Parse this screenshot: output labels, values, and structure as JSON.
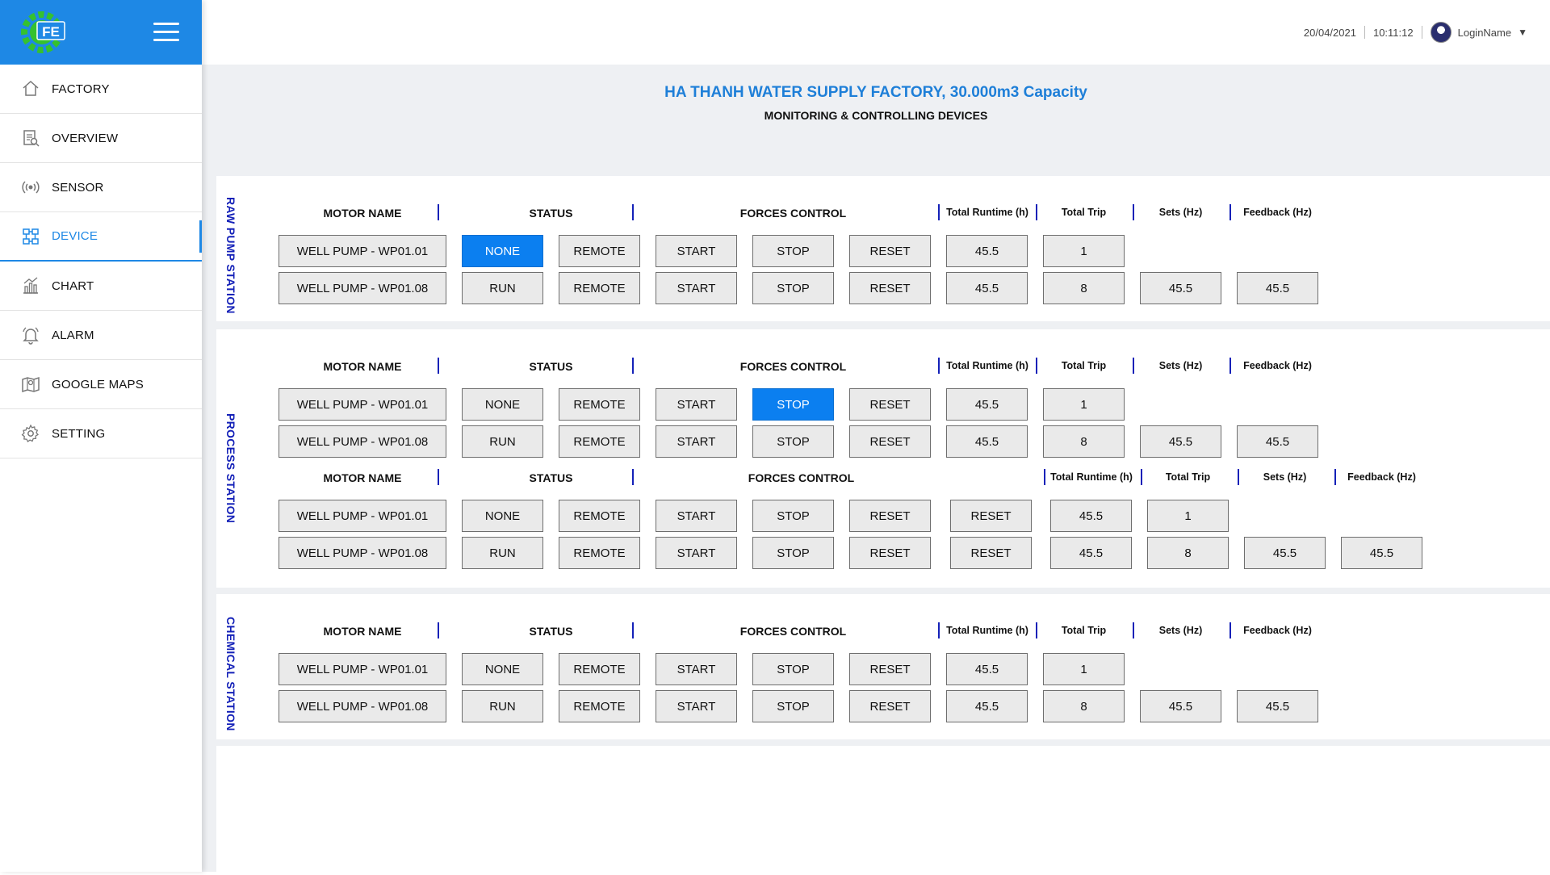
{
  "brand": {
    "logo_text": "FE"
  },
  "nav": [
    {
      "label": "FACTORY",
      "icon": "home-icon"
    },
    {
      "label": "OVERVIEW",
      "icon": "overview-icon"
    },
    {
      "label": "SENSOR",
      "icon": "sensor-icon"
    },
    {
      "label": "DEVICE",
      "icon": "device-icon",
      "active": true
    },
    {
      "label": "CHART",
      "icon": "chart-icon"
    },
    {
      "label": "ALARM",
      "icon": "bell-icon"
    },
    {
      "label": "GOOGLE MAPS",
      "icon": "map-icon"
    },
    {
      "label": "SETTING",
      "icon": "gear-icon"
    }
  ],
  "topbar": {
    "date": "20/04/2021",
    "time": "10:11:12",
    "user": "LoginName",
    "caret": "▼"
  },
  "page": {
    "title": "HA THANH WATER SUPPLY FACTORY, 30.000m3 Capacity",
    "subtitle": "MONITORING & CONTROLLING DEVICES"
  },
  "headers": {
    "motor_name": "MOTOR NAME",
    "status": "STATUS",
    "forces_control": "FORCES CONTROL",
    "total_runtime": "Total Runtime (h)",
    "total_trip": "Total Trip",
    "sets": "Sets (Hz)",
    "feedback": "Feedback (Hz)"
  },
  "stations": [
    {
      "name": "RAW PUMP STATION",
      "rows": [
        {
          "motor": "WELL PUMP - WP01.01",
          "status": "NONE",
          "mode": "REMOTE",
          "start": "START",
          "stop": "STOP",
          "reset": "RESET",
          "runtime": "45.5",
          "trip": "1",
          "sets": "",
          "feedback": "",
          "highlight": "status"
        },
        {
          "motor": "WELL PUMP - WP01.08",
          "status": "RUN",
          "mode": "REMOTE",
          "start": "START",
          "stop": "STOP",
          "reset": "RESET",
          "runtime": "45.5",
          "trip": "8",
          "sets": "45.5",
          "feedback": "45.5"
        }
      ]
    },
    {
      "name": "PROCESS STATION",
      "rows": [
        {
          "motor": "WELL PUMP - WP01.01",
          "status": "NONE",
          "mode": "REMOTE",
          "start": "START",
          "stop": "STOP",
          "reset": "RESET",
          "runtime": "45.5",
          "trip": "1",
          "highlight": "stop"
        },
        {
          "motor": "WELL PUMP - WP01.08",
          "status": "RUN",
          "mode": "REMOTE",
          "start": "START",
          "stop": "STOP",
          "reset": "RESET",
          "runtime": "45.5",
          "trip": "8",
          "sets": "45.5",
          "feedback": "45.5"
        }
      ],
      "rows_b": [
        {
          "motor": "WELL PUMP - WP01.01",
          "status": "NONE",
          "mode": "REMOTE",
          "start": "START",
          "stop": "STOP",
          "reset": "RESET",
          "reset2": "RESET",
          "runtime": "45.5",
          "trip": "1"
        },
        {
          "motor": "WELL PUMP - WP01.08",
          "status": "RUN",
          "mode": "REMOTE",
          "start": "START",
          "stop": "STOP",
          "reset": "RESET",
          "reset2": "RESET",
          "runtime": "45.5",
          "trip": "8",
          "sets": "45.5",
          "feedback": "45.5"
        }
      ]
    },
    {
      "name": "CHEMICAL STATION",
      "rows": [
        {
          "motor": "WELL PUMP - WP01.01",
          "status": "NONE",
          "mode": "REMOTE",
          "start": "START",
          "stop": "STOP",
          "reset": "RESET",
          "runtime": "45.5",
          "trip": "1"
        },
        {
          "motor": "WELL PUMP - WP01.08",
          "status": "RUN",
          "mode": "REMOTE",
          "start": "START",
          "stop": "STOP",
          "reset": "RESET",
          "runtime": "45.5",
          "trip": "8",
          "sets": "45.5",
          "feedback": "45.5"
        }
      ]
    }
  ],
  "colors": {
    "accent": "#1e88e5",
    "highlight": "#0b7ff0",
    "station_label": "#1421b8",
    "title": "#1e7fd8"
  }
}
